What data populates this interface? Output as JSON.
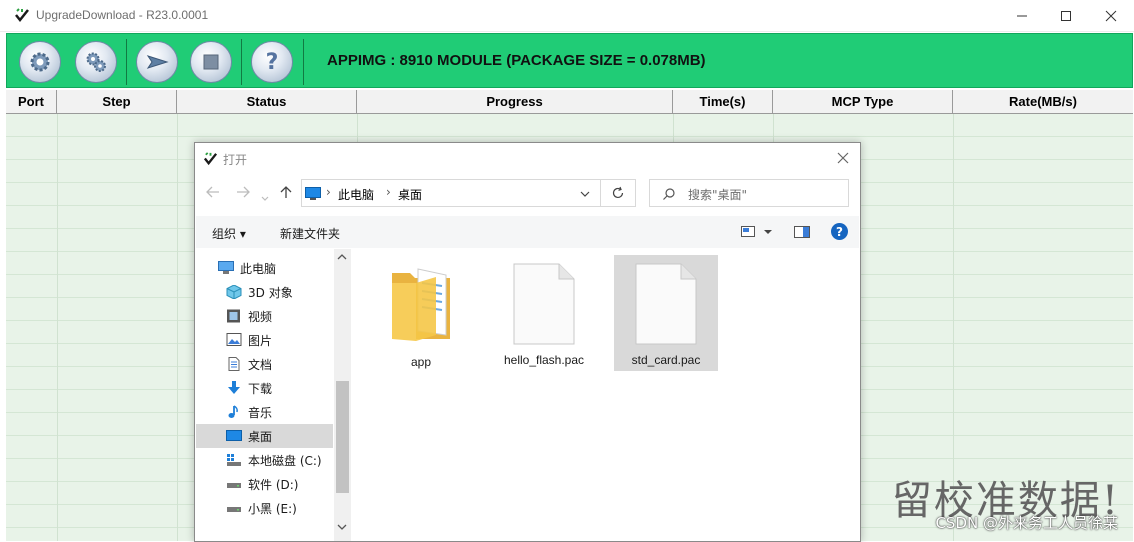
{
  "window": {
    "title": "UpgradeDownload - R23.0.0001"
  },
  "toolbar": {
    "module_text": "APPIMG : 8910 MODULE (PACKAGE SIZE = 0.078MB)",
    "buttons": [
      "settings-gear-icon",
      "multi-gear-icon",
      "start-arrow-icon",
      "stop-square-icon",
      "help-question-icon"
    ],
    "help_glyph": "?"
  },
  "grid": {
    "columns": [
      "Port",
      "Step",
      "Status",
      "Progress",
      "Time(s)",
      "MCP Type",
      "Rate(MB/s)"
    ]
  },
  "watermark": {
    "text": "留校准数据!",
    "csdn": "CSDN @外来务工人员徐某"
  },
  "dialog": {
    "title": "打开",
    "address": {
      "segments": [
        "此电脑",
        "桌面"
      ],
      "separator": "›"
    },
    "search_placeholder": "搜索\"桌面\"",
    "commands": {
      "organize": "组织 ▾",
      "new_folder": "新建文件夹"
    },
    "help_glyph": "?",
    "nav_items": [
      {
        "label": "此电脑",
        "icon": "computer-icon"
      },
      {
        "label": "3D 对象",
        "icon": "cube-3d-icon"
      },
      {
        "label": "视频",
        "icon": "video-icon"
      },
      {
        "label": "图片",
        "icon": "picture-icon"
      },
      {
        "label": "文档",
        "icon": "document-icon"
      },
      {
        "label": "下载",
        "icon": "download-icon"
      },
      {
        "label": "音乐",
        "icon": "music-icon"
      },
      {
        "label": "桌面",
        "icon": "desktop-icon",
        "selected": true
      },
      {
        "label": "本地磁盘 (C:)",
        "icon": "drive-c-icon"
      },
      {
        "label": "软件 (D:)",
        "icon": "drive-icon"
      },
      {
        "label": "小黑 (E:)",
        "icon": "drive-icon"
      }
    ],
    "files": [
      {
        "name": "app",
        "type": "folder"
      },
      {
        "name": "hello_flash.pac",
        "type": "file"
      },
      {
        "name": "std_card.pac",
        "type": "file",
        "selected": true
      }
    ]
  },
  "colors": {
    "toolbar_green": "#20cc76",
    "grid_bg": "#e8f3e8",
    "selection": "#d9d9d9",
    "help_blue": "#1665c0"
  }
}
